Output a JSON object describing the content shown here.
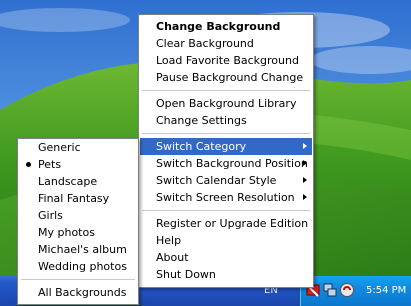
{
  "main_menu": {
    "items": [
      {
        "label": "Change Background"
      },
      {
        "label": "Clear Background"
      },
      {
        "label": "Load Favorite Background"
      },
      {
        "label": "Pause Background Change"
      },
      {
        "label": "Open Background Library"
      },
      {
        "label": "Change Settings"
      },
      {
        "label": "Switch Category"
      },
      {
        "label": "Switch Background Position"
      },
      {
        "label": "Switch Calendar Style"
      },
      {
        "label": "Switch Screen Resolution"
      },
      {
        "label": "Register or Upgrade Edition"
      },
      {
        "label": "Help"
      },
      {
        "label": "About"
      },
      {
        "label": "Shut Down"
      }
    ]
  },
  "category_menu": {
    "items": [
      {
        "label": "Generic"
      },
      {
        "label": "Pets",
        "selected": true
      },
      {
        "label": "Landscape"
      },
      {
        "label": "Final Fantasy"
      },
      {
        "label": "Girls"
      },
      {
        "label": "My photos"
      },
      {
        "label": "Michael's album"
      },
      {
        "label": "Wedding photos"
      },
      {
        "label": "All Backgrounds"
      }
    ]
  },
  "taskbar": {
    "language": "EN",
    "clock": "5:54 PM"
  },
  "colors": {
    "menu_highlight": "#316ac5",
    "taskbar": "#2559c8",
    "tray": "#0f8ae0"
  },
  "icons": [
    "app-tray-icon",
    "network-icon",
    "security-alert-icon"
  ]
}
